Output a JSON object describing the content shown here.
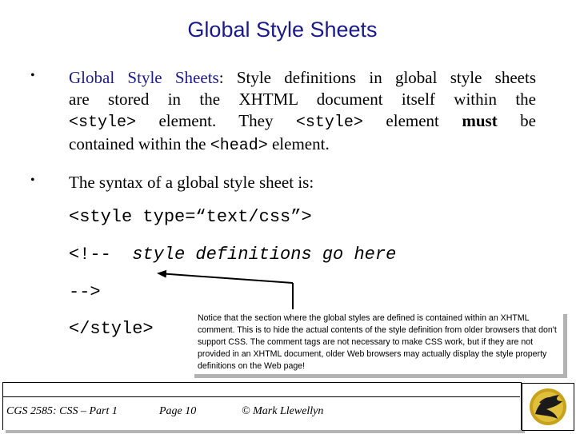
{
  "slide": {
    "title": "Global Style Sheets",
    "bullets": [
      {
        "marker": "•",
        "lines": [
          {
            "parts": [
              {
                "text": "Global Style Sheets",
                "style": "blue"
              },
              {
                "text": ":  Style definitions in global style sheets",
                "style": "normal"
              }
            ]
          },
          {
            "parts": [
              {
                "text": "are stored in the XHTML document itself within the",
                "style": "normal"
              }
            ]
          },
          {
            "parts": [
              {
                "text": "<style>",
                "style": "mono"
              },
              {
                "text": " element.  They ",
                "style": "normal"
              },
              {
                "text": "<style>",
                "style": "mono"
              },
              {
                "text": " element ",
                "style": "normal"
              },
              {
                "text": "must",
                "style": "bold"
              },
              {
                "text": " be",
                "style": "normal"
              }
            ]
          },
          {
            "parts": [
              {
                "text": "contained within the ",
                "style": "normal"
              },
              {
                "text": "<head>",
                "style": "mono"
              },
              {
                "text": " element.",
                "style": "normal"
              }
            ]
          }
        ]
      },
      {
        "marker": "•",
        "lines": [
          {
            "parts": [
              {
                "text": "The syntax of a global style sheet is:",
                "style": "normal"
              }
            ]
          }
        ]
      }
    ],
    "code": {
      "line1": "<style type=“text/css”>",
      "line2_prefix": "<!--  ",
      "line2_comment": "style definitions go here",
      "line3": "-->",
      "line4": "</style>"
    },
    "note": "Notice that the section where the global styles are defined is contained within an XHTML comment.  This is to hide the actual contents of the style definition from older browsers that don't support CSS.  The comment tags are not necessary to make CSS work, but if they are not provided in an XHTML document, older Web browsers may actually display the style property definitions on the Web page!",
    "footer": {
      "course": "CGS 2585: CSS – Part 1",
      "page": "Page 10",
      "author": "© Mark Llewellyn"
    },
    "logo": "ucf-pegasus-logo",
    "colors": {
      "title": "#1a1a8c",
      "accent_gold": "#c8a21a"
    }
  }
}
